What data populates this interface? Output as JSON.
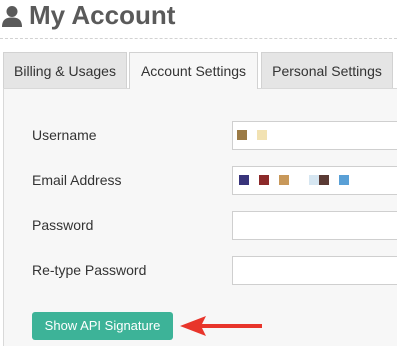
{
  "header": {
    "title": "My Account",
    "icon": "user-icon"
  },
  "tabs": [
    {
      "label": "Billing & Usages",
      "active": false
    },
    {
      "label": "Account Settings",
      "active": true
    },
    {
      "label": "Personal Settings",
      "active": false
    }
  ],
  "form": {
    "username_label": "Username",
    "email_label": "Email Address",
    "password_label": "Password",
    "retype_label": "Re-type Password"
  },
  "api_button": {
    "label": "Show API Signature",
    "color": "#3db398"
  },
  "annotation": {
    "icon": "arrow-left-icon",
    "color": "#e8352b"
  }
}
